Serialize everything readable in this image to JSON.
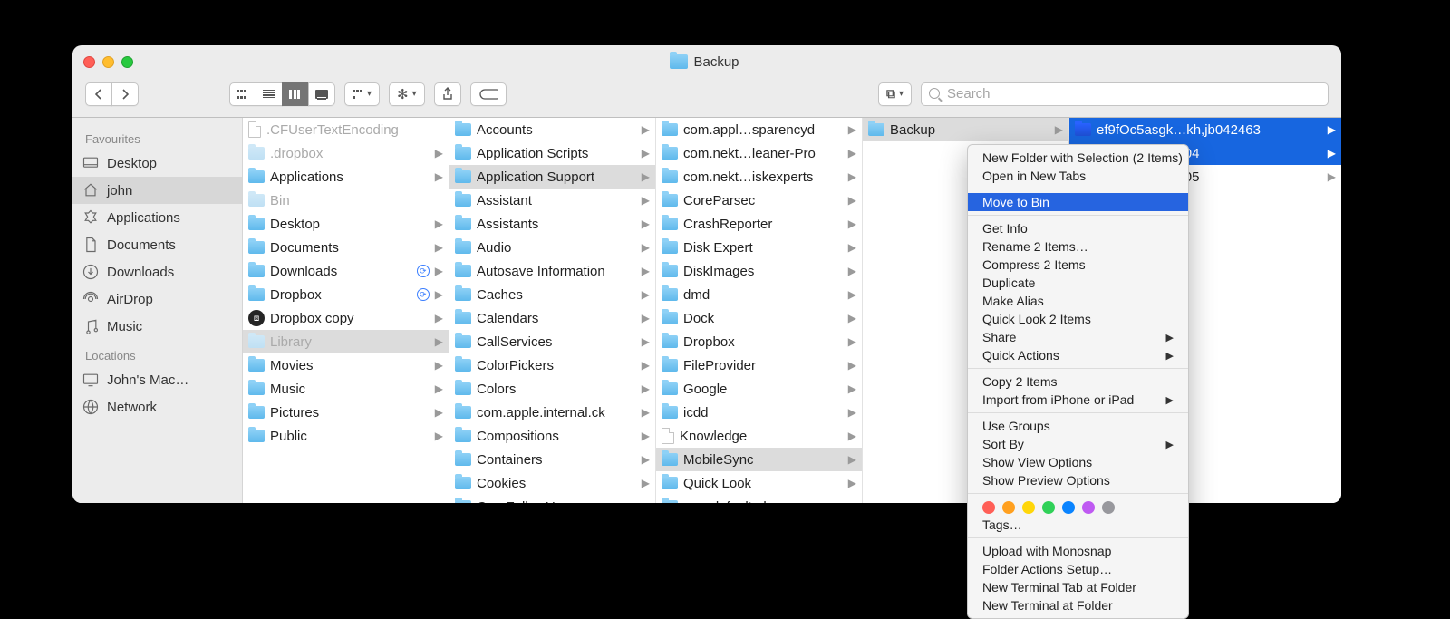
{
  "window": {
    "title": "Backup"
  },
  "search": {
    "placeholder": "Search"
  },
  "sidebar": {
    "sections": [
      {
        "title": "Favourites",
        "items": [
          {
            "icon": "desktop",
            "label": "Desktop"
          },
          {
            "icon": "home",
            "label": "john",
            "selected": true
          },
          {
            "icon": "apps",
            "label": "Applications"
          },
          {
            "icon": "document",
            "label": "Documents"
          },
          {
            "icon": "downloads",
            "label": "Downloads"
          },
          {
            "icon": "airdrop",
            "label": "AirDrop"
          },
          {
            "icon": "music",
            "label": "Music"
          }
        ]
      },
      {
        "title": "Locations",
        "items": [
          {
            "icon": "mac",
            "label": "John's Mac…"
          },
          {
            "icon": "network",
            "label": "Network"
          }
        ]
      }
    ]
  },
  "columns": [
    [
      {
        "label": ".CFUserTextEncoding",
        "type": "doc",
        "dim": true
      },
      {
        "label": ".dropbox",
        "type": "folder",
        "dim": true,
        "chev": true
      },
      {
        "label": "Applications",
        "type": "folder",
        "chev": true
      },
      {
        "label": "Bin",
        "type": "folder",
        "dim": true
      },
      {
        "label": "Desktop",
        "type": "folder",
        "chev": true
      },
      {
        "label": "Documents",
        "type": "folder",
        "chev": true
      },
      {
        "label": "Downloads",
        "type": "folder",
        "chev": true,
        "badge": "sync"
      },
      {
        "label": "Dropbox",
        "type": "folder",
        "chev": true,
        "badge": "sync"
      },
      {
        "label": "Dropbox copy",
        "type": "dropbox",
        "chev": true
      },
      {
        "label": "Library",
        "type": "folder",
        "dim": true,
        "chev": true,
        "sel": "grey"
      },
      {
        "label": "Movies",
        "type": "folder",
        "chev": true
      },
      {
        "label": "Music",
        "type": "folder",
        "chev": true
      },
      {
        "label": "Pictures",
        "type": "folder",
        "chev": true
      },
      {
        "label": "Public",
        "type": "folder",
        "chev": true
      }
    ],
    [
      {
        "label": "Accounts",
        "type": "folder",
        "chev": true
      },
      {
        "label": "Application Scripts",
        "type": "folder",
        "chev": true
      },
      {
        "label": "Application Support",
        "type": "folder",
        "chev": true,
        "sel": "grey"
      },
      {
        "label": "Assistant",
        "type": "folder",
        "chev": true
      },
      {
        "label": "Assistants",
        "type": "folder",
        "chev": true
      },
      {
        "label": "Audio",
        "type": "folder",
        "chev": true
      },
      {
        "label": "Autosave Information",
        "type": "folder",
        "chev": true
      },
      {
        "label": "Caches",
        "type": "folder",
        "chev": true
      },
      {
        "label": "Calendars",
        "type": "folder",
        "chev": true
      },
      {
        "label": "CallServices",
        "type": "folder",
        "chev": true
      },
      {
        "label": "ColorPickers",
        "type": "folder",
        "chev": true
      },
      {
        "label": "Colors",
        "type": "folder",
        "chev": true
      },
      {
        "label": "com.apple.internal.ck",
        "type": "folder",
        "chev": true
      },
      {
        "label": "Compositions",
        "type": "folder",
        "chev": true
      },
      {
        "label": "Containers",
        "type": "folder",
        "chev": true
      },
      {
        "label": "Cookies",
        "type": "folder",
        "chev": true
      },
      {
        "label": "CoreFollowUp",
        "type": "folder",
        "chev": true
      }
    ],
    [
      {
        "label": "com.appl…sparencyd",
        "type": "folder",
        "chev": true
      },
      {
        "label": "com.nekt…leaner-Pro",
        "type": "folder",
        "chev": true
      },
      {
        "label": "com.nekt…iskexperts",
        "type": "folder",
        "chev": true
      },
      {
        "label": "CoreParsec",
        "type": "folder",
        "chev": true
      },
      {
        "label": "CrashReporter",
        "type": "folder",
        "chev": true
      },
      {
        "label": "Disk Expert",
        "type": "folder",
        "chev": true
      },
      {
        "label": "DiskImages",
        "type": "folder",
        "chev": true
      },
      {
        "label": "dmd",
        "type": "folder",
        "chev": true
      },
      {
        "label": "Dock",
        "type": "folder",
        "chev": true
      },
      {
        "label": "Dropbox",
        "type": "folder",
        "chev": true
      },
      {
        "label": "FileProvider",
        "type": "folder",
        "chev": true
      },
      {
        "label": "Google",
        "type": "folder",
        "chev": true
      },
      {
        "label": "icdd",
        "type": "folder",
        "chev": true
      },
      {
        "label": "Knowledge",
        "type": "doc",
        "chev": true
      },
      {
        "label": "MobileSync",
        "type": "folder",
        "chev": true,
        "sel": "grey"
      },
      {
        "label": "Quick Look",
        "type": "folder",
        "chev": true
      },
      {
        "label": "syncdefaultsd",
        "type": "folder",
        "chev": true
      }
    ],
    [
      {
        "label": "Backup",
        "type": "folder",
        "chev": true,
        "sel": "grey"
      }
    ],
    [
      {
        "label": "ef9fOc5asgk…kh,jb042463",
        "type": "folder",
        "chev": true,
        "sel": "blue"
      },
      {
        "label": "sg…0424c82e04",
        "type": "folder",
        "chev": true,
        "sel": "blue"
      },
      {
        "label": "sg…0424c82e05",
        "type": "folder",
        "chev": true
      }
    ]
  ],
  "ctx": {
    "items": [
      "New Folder with Selection (2 Items)",
      "Open in New Tabs",
      "-",
      "!Move to Bin",
      "-",
      "Get Info",
      "Rename 2 Items…",
      "Compress 2 Items",
      "Duplicate",
      "Make Alias",
      "Quick Look 2 Items",
      ">Share",
      ">Quick Actions",
      "-",
      "Copy 2 Items",
      ">Import from iPhone or iPad",
      "-",
      "Use Groups",
      ">Sort By",
      "Show View Options",
      "Show Preview Options",
      "-",
      "TAGS",
      "Tags…",
      "-",
      "Upload with Monosnap",
      "Folder Actions Setup…",
      "New Terminal Tab at Folder",
      "New Terminal at Folder"
    ],
    "tag_colors": [
      "#ff5f57",
      "#ffa01f",
      "#ffd60a",
      "#30d158",
      "#0a84ff",
      "#bf5af2",
      "#98989d"
    ]
  }
}
